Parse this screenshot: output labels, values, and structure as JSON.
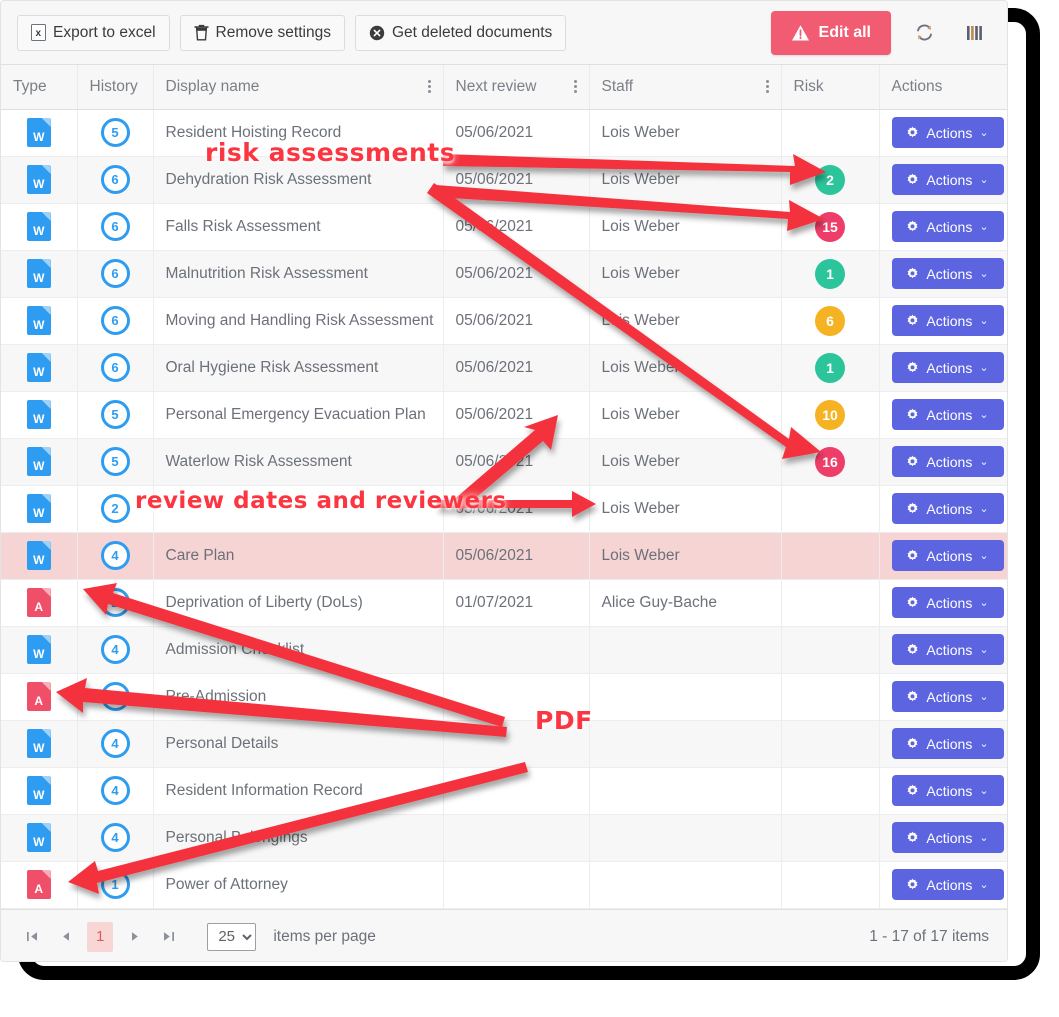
{
  "toolbar": {
    "export_label": "Export to excel",
    "export_icon": "excel-file-icon",
    "remove_label": "Remove settings",
    "remove_icon": "trash-icon",
    "deleted_label": "Get deleted documents",
    "deleted_icon": "circle-x-icon",
    "edit_all_label": "Edit all",
    "edit_all_icon": "warning-triangle-icon",
    "edit_all_color": "#f25c72",
    "refresh_icon": "refresh-icon",
    "columns_icon": "columns-icon"
  },
  "table": {
    "columns": [
      {
        "key": "type",
        "label": "Type",
        "menu": false
      },
      {
        "key": "history",
        "label": "History",
        "menu": false
      },
      {
        "key": "name",
        "label": "Display name",
        "menu": true
      },
      {
        "key": "review",
        "label": "Next review",
        "menu": true
      },
      {
        "key": "staff",
        "label": "Staff",
        "menu": true
      },
      {
        "key": "risk",
        "label": "Risk",
        "menu": false
      },
      {
        "key": "actions",
        "label": "Actions",
        "menu": false
      }
    ],
    "action_label": "Actions",
    "action_icon": "gear-icon",
    "action_caret_icon": "chevron-down-icon",
    "rows": [
      {
        "type": "word",
        "type_label": "W",
        "history": "5",
        "name": "Resident Hoisting Record",
        "review": "05/06/2021",
        "staff": "Lois Weber",
        "risk": "",
        "risk_level": "",
        "highlight": "none"
      },
      {
        "type": "word",
        "type_label": "W",
        "history": "6",
        "name": "Dehydration Risk Assessment",
        "review": "05/06/2021",
        "staff": "Lois Weber",
        "risk": "2",
        "risk_level": "low",
        "highlight": "alt"
      },
      {
        "type": "word",
        "type_label": "W",
        "history": "6",
        "name": "Falls Risk Assessment",
        "review": "05/06/2021",
        "staff": "Lois Weber",
        "risk": "15",
        "risk_level": "high",
        "highlight": "none"
      },
      {
        "type": "word",
        "type_label": "W",
        "history": "6",
        "name": "Malnutrition Risk Assessment",
        "review": "05/06/2021",
        "staff": "Lois Weber",
        "risk": "1",
        "risk_level": "low",
        "highlight": "alt"
      },
      {
        "type": "word",
        "type_label": "W",
        "history": "6",
        "name": "Moving and Handling Risk Assessment",
        "review": "05/06/2021",
        "staff": "Lois Weber",
        "risk": "6",
        "risk_level": "med",
        "highlight": "none"
      },
      {
        "type": "word",
        "type_label": "W",
        "history": "6",
        "name": "Oral Hygiene Risk Assessment",
        "review": "05/06/2021",
        "staff": "Lois Weber",
        "risk": "1",
        "risk_level": "low",
        "highlight": "alt"
      },
      {
        "type": "word",
        "type_label": "W",
        "history": "5",
        "name": "Personal Emergency Evacuation Plan",
        "review": "05/06/2021",
        "staff": "Lois Weber",
        "risk": "10",
        "risk_level": "med",
        "highlight": "none"
      },
      {
        "type": "word",
        "type_label": "W",
        "history": "5",
        "name": "Waterlow Risk Assessment",
        "review": "05/06/2021",
        "staff": "Lois Weber",
        "risk": "16",
        "risk_level": "high",
        "highlight": "alt"
      },
      {
        "type": "word",
        "type_label": "W",
        "history": "2",
        "name": "",
        "review": "05/06/2021",
        "staff": "Lois Weber",
        "risk": "",
        "risk_level": "",
        "highlight": "none"
      },
      {
        "type": "word",
        "type_label": "W",
        "history": "4",
        "name": "Care Plan",
        "review": "05/06/2021",
        "staff": "Lois Weber",
        "risk": "",
        "risk_level": "",
        "highlight": "danger"
      },
      {
        "type": "pdf",
        "type_label": "A",
        "history": "2",
        "name": "Deprivation of Liberty (DoLs)",
        "review": "01/07/2021",
        "staff": "Alice Guy-Bache",
        "risk": "",
        "risk_level": "",
        "highlight": "none"
      },
      {
        "type": "word",
        "type_label": "W",
        "history": "4",
        "name": "Admission Checklist",
        "review": "",
        "staff": "",
        "risk": "",
        "risk_level": "",
        "highlight": "alt"
      },
      {
        "type": "pdf",
        "type_label": "A",
        "history": "1",
        "name": "Pre-Admission",
        "review": "",
        "staff": "",
        "risk": "",
        "risk_level": "",
        "highlight": "none"
      },
      {
        "type": "word",
        "type_label": "W",
        "history": "4",
        "name": "Personal Details",
        "review": "",
        "staff": "",
        "risk": "",
        "risk_level": "",
        "highlight": "alt"
      },
      {
        "type": "word",
        "type_label": "W",
        "history": "4",
        "name": "Resident Information Record",
        "review": "",
        "staff": "",
        "risk": "",
        "risk_level": "",
        "highlight": "none"
      },
      {
        "type": "word",
        "type_label": "W",
        "history": "4",
        "name": "Personal Belongings",
        "review": "",
        "staff": "",
        "risk": "",
        "risk_level": "",
        "highlight": "alt"
      },
      {
        "type": "pdf",
        "type_label": "A",
        "history": "1",
        "name": "Power of Attorney",
        "review": "",
        "staff": "",
        "risk": "",
        "risk_level": "",
        "highlight": "none"
      }
    ]
  },
  "pager": {
    "first_icon": "first-page-icon",
    "prev_icon": "prev-page-icon",
    "next_icon": "next-page-icon",
    "last_icon": "last-page-icon",
    "current_page": "1",
    "page_size": "25",
    "page_size_options": [
      "25"
    ],
    "items_per_page_label": "items per page",
    "count_label": "1 - 17 of 17 items"
  },
  "annotations": {
    "risk": "risk assessments",
    "review": "review dates and reviewers",
    "pdf": "PDF",
    "color": "#fb3640"
  }
}
